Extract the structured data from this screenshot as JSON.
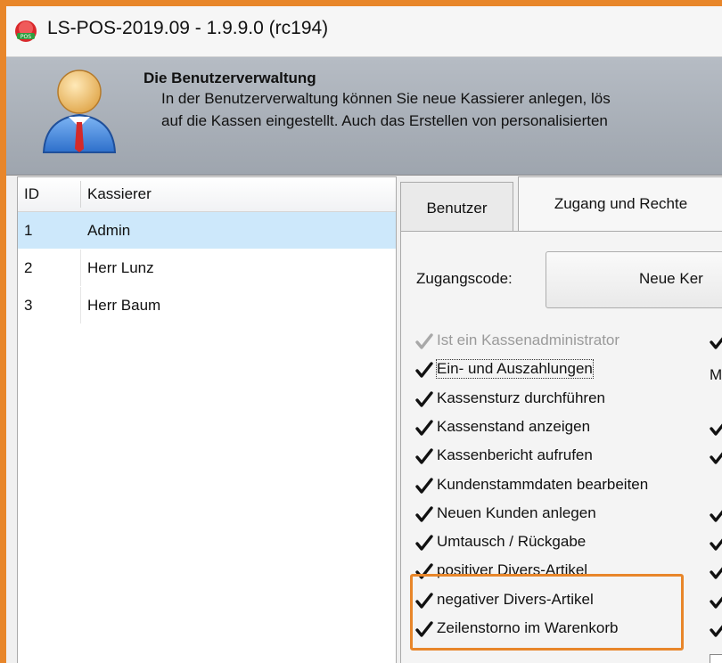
{
  "window": {
    "title": "LS-POS-2019.09 - 1.9.9.0 (rc194)"
  },
  "banner": {
    "title": "Die Benutzerverwaltung",
    "line1": "In der Benutzerverwaltung können Sie neue Kassierer anlegen, lös",
    "line2": "auf die Kassen eingestellt. Auch das Erstellen von personalisierten"
  },
  "user_list": {
    "columns": [
      "ID",
      "Kassierer"
    ],
    "rows": [
      {
        "id": "1",
        "name": "Admin",
        "selected": true
      },
      {
        "id": "2",
        "name": "Herr Lunz",
        "selected": false
      },
      {
        "id": "3",
        "name": "Herr Baum",
        "selected": false
      }
    ]
  },
  "tabs": {
    "benutzer": "Benutzer",
    "zugang": "Zugang und Rechte",
    "active": "zugang"
  },
  "access": {
    "code_label": "Zugangscode:",
    "code_button": "Neue Ker",
    "stray_letter": "M"
  },
  "permissions": [
    {
      "label": "Ist ein Kassenadministrator",
      "checked": true,
      "enabled": false
    },
    {
      "label": "Ein- und Auszahlungen",
      "checked": true,
      "enabled": true,
      "focused": true
    },
    {
      "label": "Kassensturz durchführen",
      "checked": true,
      "enabled": true
    },
    {
      "label": "Kassenstand anzeigen",
      "checked": true,
      "enabled": true
    },
    {
      "label": "Kassenbericht aufrufen",
      "checked": true,
      "enabled": true
    },
    {
      "label": "Kundenstammdaten bearbeiten",
      "checked": true,
      "enabled": true
    },
    {
      "label": "Neuen Kunden anlegen",
      "checked": true,
      "enabled": true
    },
    {
      "label": "Umtausch / Rückgabe",
      "checked": true,
      "enabled": true
    },
    {
      "label": "positiver Divers-Artikel",
      "checked": true,
      "enabled": true
    },
    {
      "label": "negativer Divers-Artikel",
      "checked": true,
      "enabled": true
    },
    {
      "label": "Zeilenstorno im Warenkorb",
      "checked": true,
      "enabled": true
    }
  ],
  "colors": {
    "annotation": "#e8862a",
    "selection": "#cde8fb"
  }
}
